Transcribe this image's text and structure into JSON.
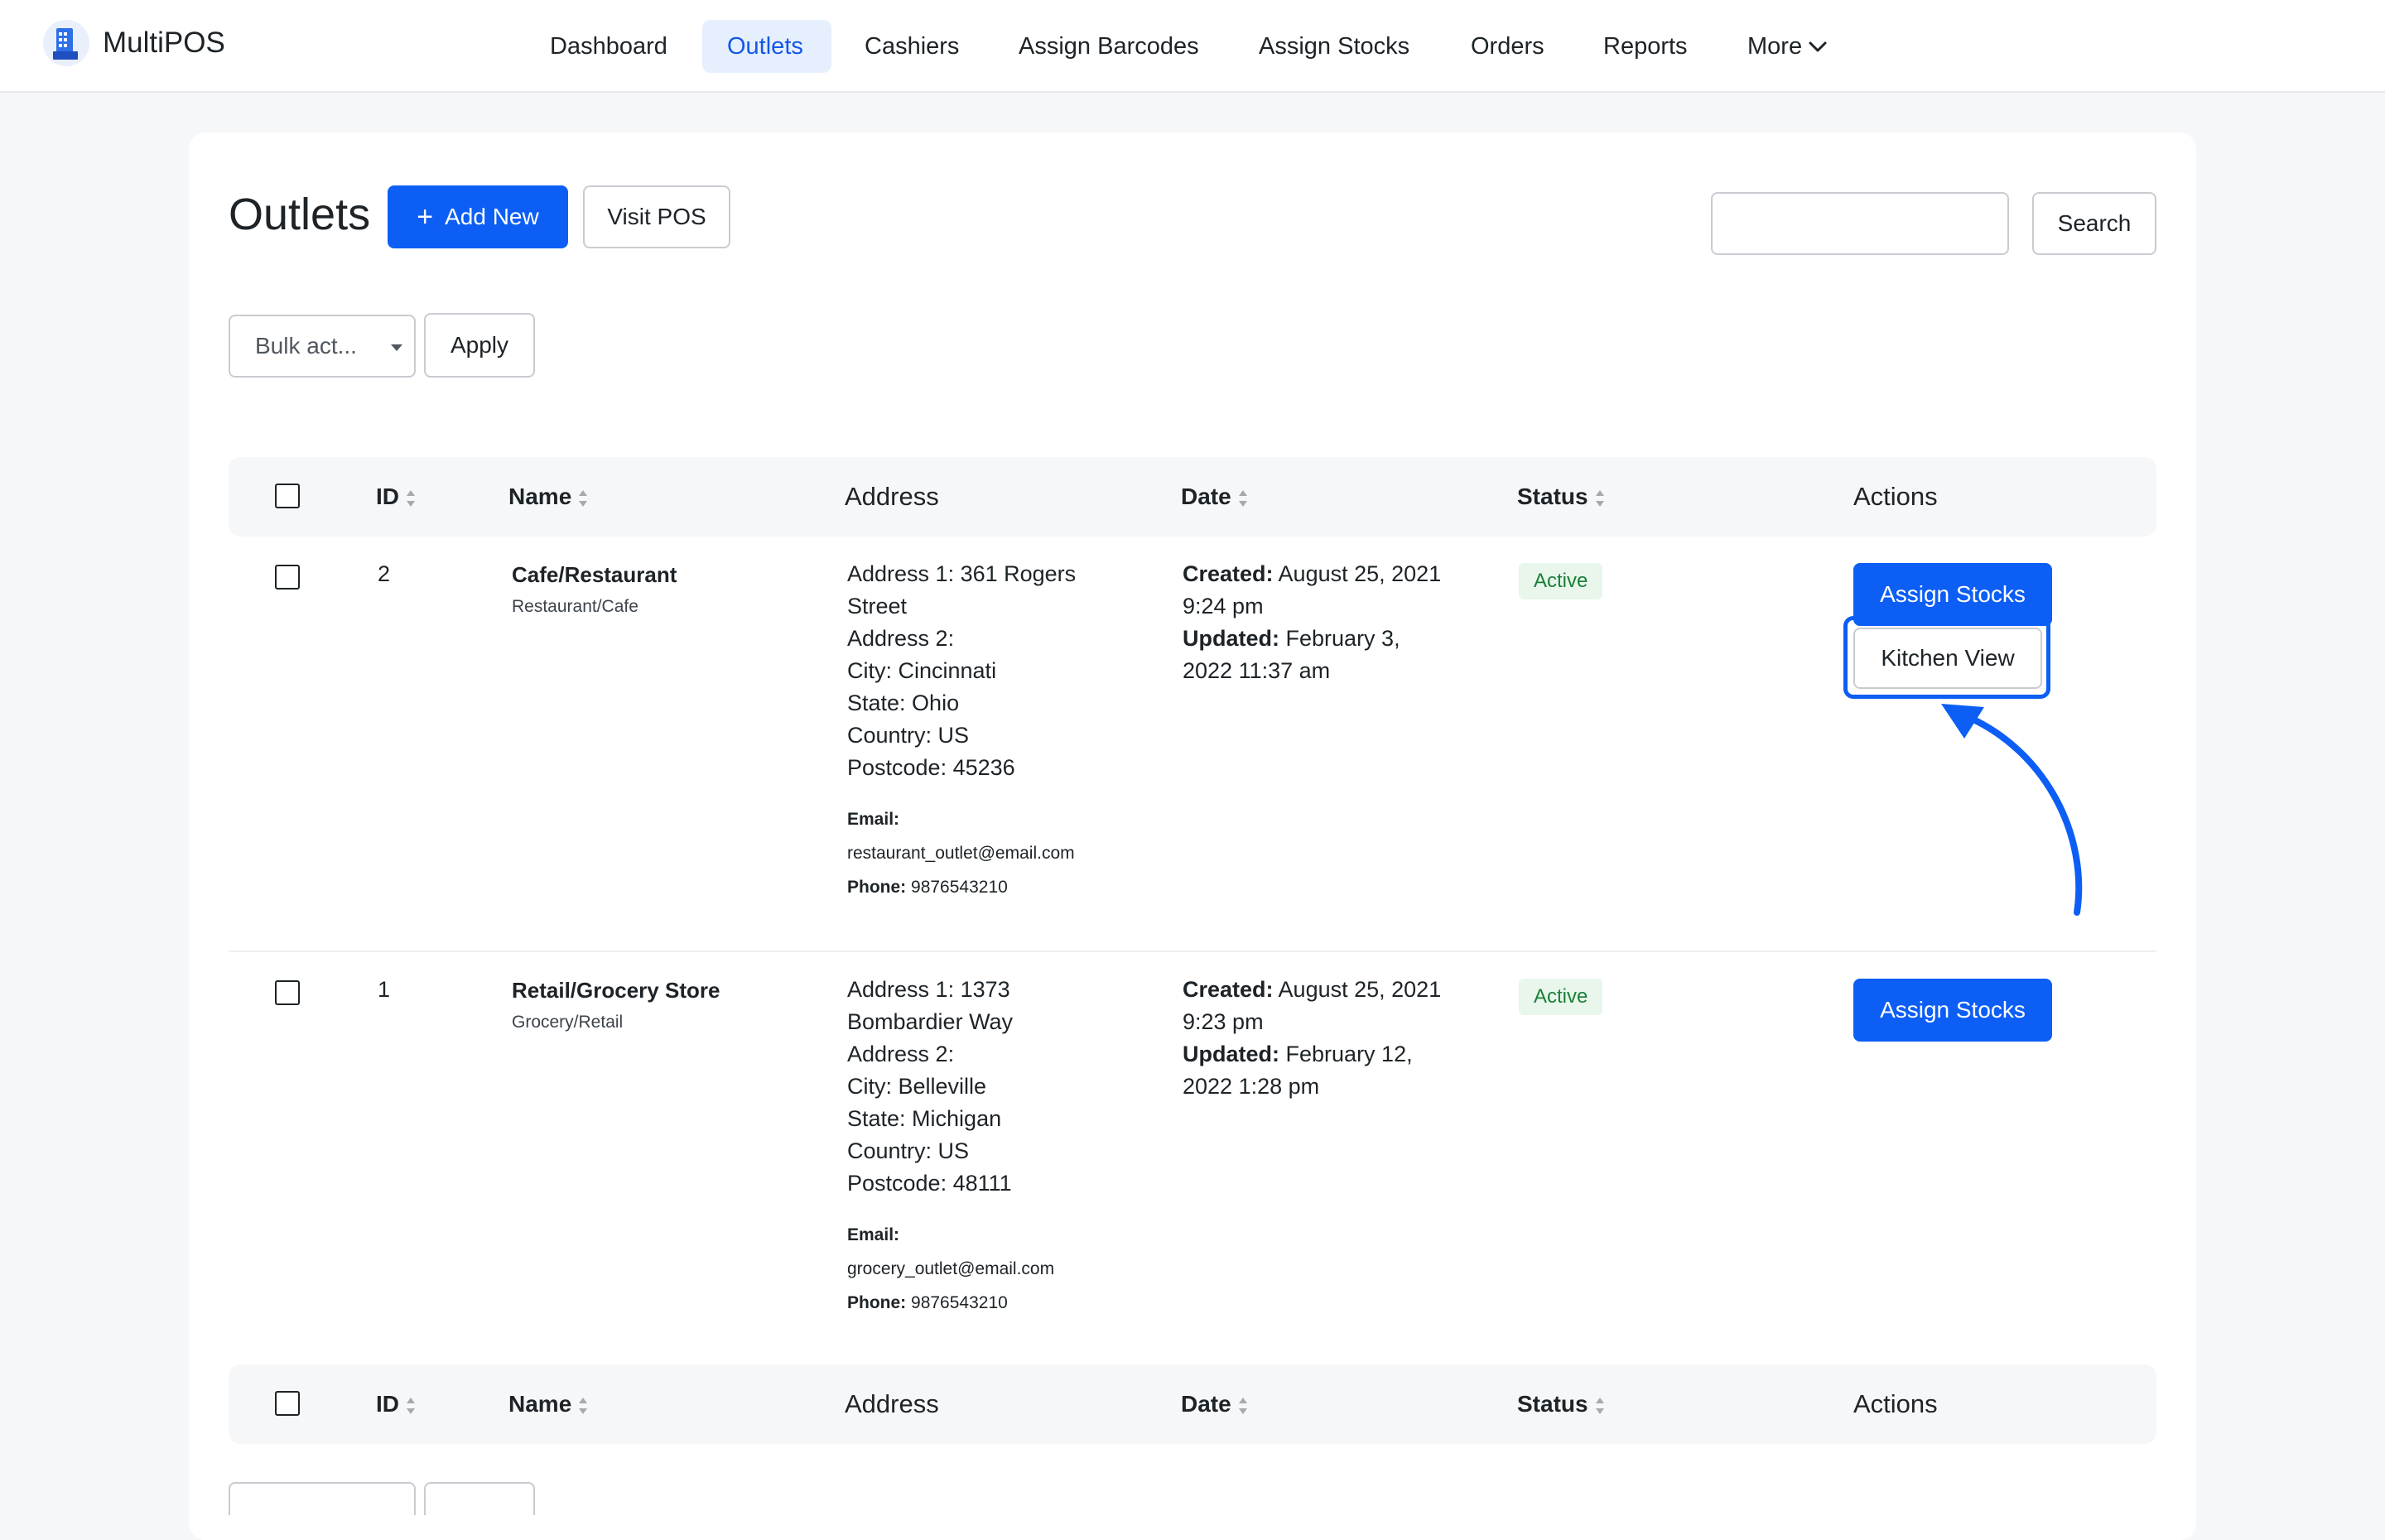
{
  "app": {
    "name": "MultiPOS"
  },
  "nav": {
    "items": [
      {
        "label": "Dashboard"
      },
      {
        "label": "Outlets"
      },
      {
        "label": "Cashiers"
      },
      {
        "label": "Assign Barcodes"
      },
      {
        "label": "Assign Stocks"
      },
      {
        "label": "Orders"
      },
      {
        "label": "Reports"
      },
      {
        "label": "More"
      }
    ],
    "active": "Outlets"
  },
  "page": {
    "title": "Outlets",
    "add_new_label": "Add New",
    "visit_pos_label": "Visit POS",
    "search_value": "",
    "search_button_label": "Search",
    "bulk_action_value": "Bulk act...",
    "apply_label": "Apply"
  },
  "table": {
    "columns": [
      "ID",
      "Name",
      "Address",
      "Date",
      "Status",
      "Actions"
    ],
    "rows": [
      {
        "id": "2",
        "name": "Cafe/Restaurant",
        "type": "Restaurant/Cafe",
        "address_line1": "Address 1: 361 Rogers",
        "address_line1b": "Street",
        "address_line2": "Address 2:",
        "city": "City: Cincinnati",
        "state": "State: Ohio",
        "country": "Country: US",
        "postcode": "Postcode: 45236",
        "email_label": "Email:",
        "email": "restaurant_outlet@email.com",
        "phone_label": "Phone:",
        "phone": "9876543210",
        "created_label": "Created:",
        "created_a": "August 25, 2021",
        "created_b": "9:24 pm",
        "updated_label": "Updated:",
        "updated_a": "February 3,",
        "updated_b": "2022 11:37 am",
        "status": "Active",
        "action_primary": "Assign Stocks",
        "action_secondary": "Kitchen View"
      },
      {
        "id": "1",
        "name": "Retail/Grocery Store",
        "type": "Grocery/Retail",
        "address_line1": "Address 1: 1373",
        "address_line1b": "Bombardier Way",
        "address_line2": "Address 2:",
        "city": "City: Belleville",
        "state": "State: Michigan",
        "country": "Country: US",
        "postcode": "Postcode: 48111",
        "email_label": "Email:",
        "email": "grocery_outlet@email.com",
        "phone_label": "Phone:",
        "phone": "9876543210",
        "created_label": "Created:",
        "created_a": "August 25, 2021",
        "created_b": "9:23 pm",
        "updated_label": "Updated:",
        "updated_a": "February 12,",
        "updated_b": "2022 1:28 pm",
        "status": "Active",
        "action_primary": "Assign Stocks"
      }
    ]
  },
  "colors": {
    "accent": "#0c5ef5",
    "active_nav_bg": "#e6effd",
    "status_bg": "#e8f6ec",
    "status_text": "#1a7f37"
  },
  "icons": [
    "store-logo-icon",
    "chevron-down-icon",
    "plus-icon",
    "sort-icon",
    "dropdown-caret-icon",
    "annotation-arrow-icon"
  ]
}
